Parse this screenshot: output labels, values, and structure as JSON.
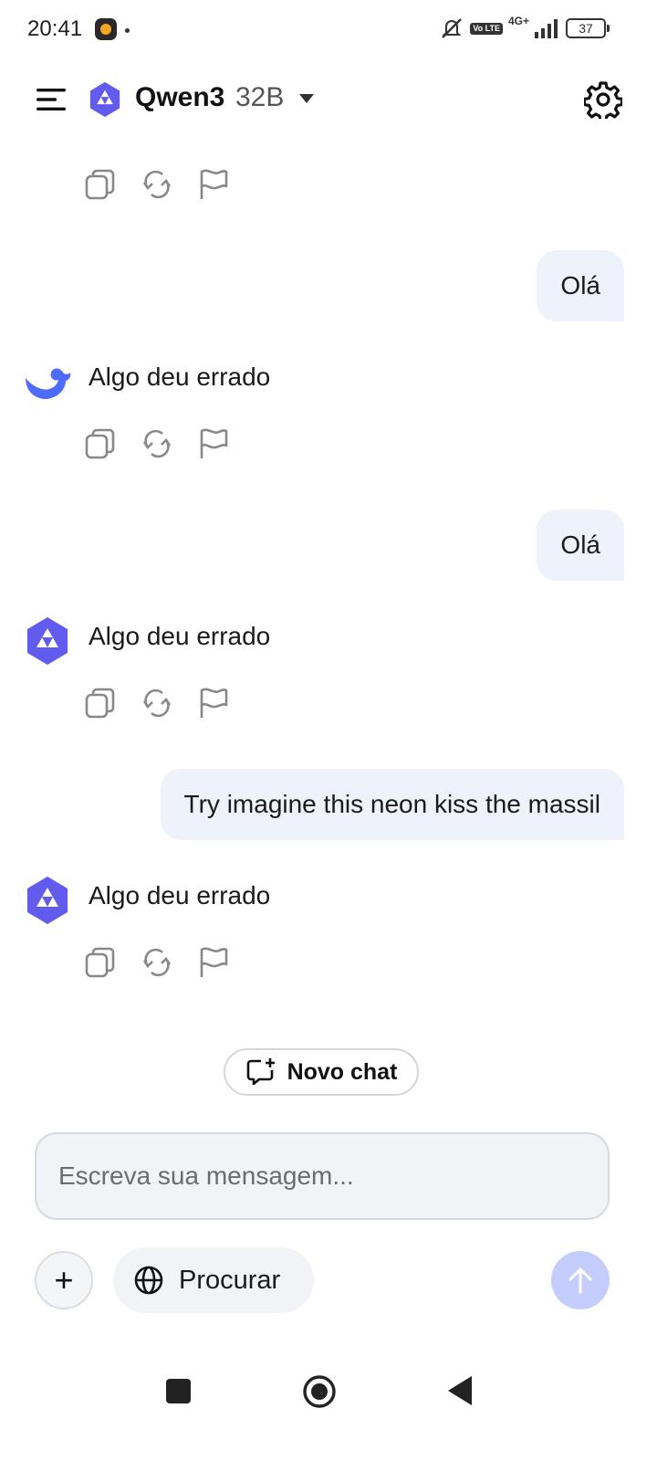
{
  "status_bar": {
    "time": "20:41",
    "network": "4G+",
    "lte_label": "Vo LTE",
    "battery": "37"
  },
  "header": {
    "model_name": "Qwen3",
    "model_size": "32B"
  },
  "messages": [
    {
      "role": "user",
      "text": "Olá"
    },
    {
      "role": "assistant",
      "avatar": "deepseek-whale-icon",
      "text": "Algo deu errado"
    },
    {
      "role": "user",
      "text": "Olá"
    },
    {
      "role": "assistant",
      "avatar": "qwen-logo-icon",
      "text": "Algo deu errado"
    },
    {
      "role": "user",
      "text": "Try imagine this neon kiss the massil"
    },
    {
      "role": "assistant",
      "avatar": "qwen-logo-icon",
      "text": "Algo deu errado"
    }
  ],
  "new_chat": {
    "label": "Novo chat"
  },
  "composer": {
    "placeholder": "Escreva sua mensagem...",
    "search_label": "Procurar",
    "plus_label": "+"
  },
  "colors": {
    "accent": "#615ced",
    "bubble": "#eef3fb",
    "send_disabled": "#c4cdfb"
  }
}
